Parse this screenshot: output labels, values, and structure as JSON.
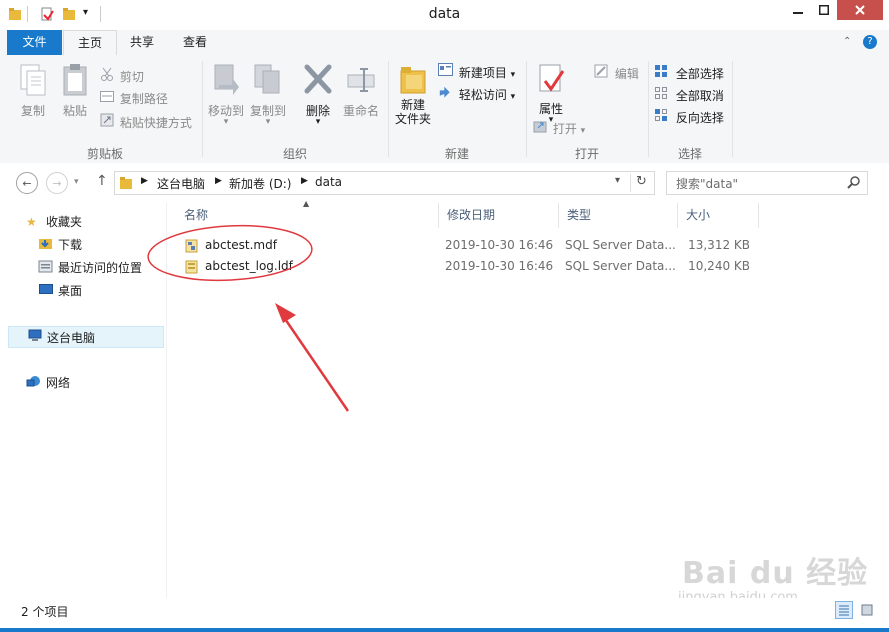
{
  "window": {
    "title": "data"
  },
  "ribbon_tabs": [
    {
      "label": "文件"
    },
    {
      "label": "主页"
    },
    {
      "label": "共享"
    },
    {
      "label": "查看"
    }
  ],
  "clipboard": {
    "copy": "复制",
    "paste": "粘贴",
    "cut": "剪切",
    "copy_path": "复制路径",
    "paste_shortcut": "粘贴快捷方式",
    "group": "剪贴板"
  },
  "organize": {
    "move_to": "移动到",
    "copy_to": "复制到",
    "delete": "删除",
    "rename": "重命名",
    "group": "组织"
  },
  "new": {
    "new_item": "新建项目",
    "easy_access": "轻松访问",
    "new_folder": "新建\n文件夹",
    "group": "新建"
  },
  "open": {
    "properties": "属性",
    "open": "打开",
    "edit": "编辑",
    "group": "打开"
  },
  "select": {
    "select_all": "全部选择",
    "select_none": "全部取消",
    "invert": "反向选择",
    "group": "选择"
  },
  "address": {
    "crumbs": [
      "这台电脑",
      "新加卷 (D:)",
      "data"
    ],
    "search_placeholder": "搜索\"data\""
  },
  "nav_pane": {
    "favorites": "收藏夹",
    "downloads": "下载",
    "recent": "最近访问的位置",
    "desktop": "桌面",
    "this_pc": "这台电脑",
    "network": "网络"
  },
  "columns": {
    "name": "名称",
    "date": "修改日期",
    "type": "类型",
    "size": "大小"
  },
  "files": [
    {
      "name": "abctest.mdf",
      "date": "2019-10-30 16:46",
      "type": "SQL Server Data...",
      "size": "13,312 KB"
    },
    {
      "name": "abctest_log.ldf",
      "date": "2019-10-30 16:46",
      "type": "SQL Server Data...",
      "size": "10,240 KB"
    }
  ],
  "status": {
    "count": "2 个项目"
  },
  "watermark": {
    "brand": "Bai du 经验",
    "url": "jingyan.baidu.com"
  },
  "colors": {
    "accent": "#1979ca",
    "annotation": "#e0393e"
  }
}
